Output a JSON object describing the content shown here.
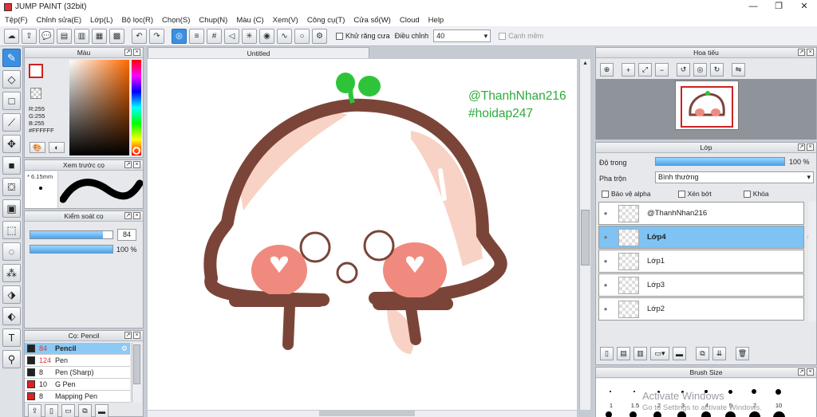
{
  "window": {
    "title": "JUMP PAINT (32bit)",
    "minimize": "—",
    "maximize": "❐",
    "close": "✕"
  },
  "menu": [
    "Tệp(F)",
    "Chỉnh sửa(E)",
    "Lớp(L)",
    "Bộ lọc(R)",
    "Chọn(S)",
    "Chup(N)",
    "Màu (C)",
    "Xem(V)",
    "Công cụ(T)",
    "Cửa sổ(W)",
    "Cloud",
    "Help"
  ],
  "toolbar": {
    "antialias_label": "Khử răng cưa",
    "adjust_label": "Điều chỉnh",
    "adjust_value": "40",
    "margin_label": "Cạnh mềm"
  },
  "color_panel": {
    "title": "Màu",
    "r": "R:255",
    "g": "G:255",
    "b": "B:255",
    "hex": "#FFFFFF",
    "primary": "#ffffff",
    "secondary": "#22cc22"
  },
  "brush_preview": {
    "title": "Xem trước cọ",
    "size": "6.15mm"
  },
  "brush_control": {
    "title": "Kiểm soát cọ",
    "size_value": "84",
    "opacity_value": "100 %",
    "size_fraction": 0.88,
    "opacity_fraction": 1.0
  },
  "brush_panel": {
    "title": "Cọ: Pencil",
    "brushes": [
      {
        "size": "84",
        "name": "Pencil",
        "color": "#222222",
        "selected": true
      },
      {
        "size": "124",
        "name": "Pen",
        "color": "#222222",
        "selected": false
      },
      {
        "size": "8",
        "name": "Pen (Sharp)",
        "color": "#222222",
        "selected": false
      },
      {
        "size": "10",
        "name": "G Pen",
        "color": "#dd2222",
        "selected": false
      },
      {
        "size": "8",
        "name": "Mapping Pen",
        "color": "#dd2222",
        "selected": false
      }
    ]
  },
  "canvas": {
    "tab_title": "Untitled",
    "watermark_1": "@ThanhNhan216",
    "watermark_2": "#hoidap247"
  },
  "navigator": {
    "title": "Hoa tiếu"
  },
  "layers": {
    "title": "Lớp",
    "opacity_label": "Độ trong",
    "opacity_value": "100 %",
    "blend_label": "Pha trộn",
    "blend_value": "Bình thường",
    "protect_alpha": "Bảo vệ alpha",
    "clip": "Xén bớt",
    "lock": "Khóa",
    "items": [
      {
        "name": "@ThanhNhan216",
        "selected": false
      },
      {
        "name": "Lớp4",
        "selected": true
      },
      {
        "name": "Lớp1",
        "selected": false
      },
      {
        "name": "Lớp3",
        "selected": false
      },
      {
        "name": "Lớp2",
        "selected": false
      }
    ]
  },
  "brush_size": {
    "title": "Brush Size",
    "labels": [
      "1",
      "1.5",
      "2",
      "3",
      "4",
      "5",
      "7",
      "10"
    ],
    "activate_1": "Activate Windows",
    "activate_2": "Go to Settings to activate Windows."
  },
  "colors": {
    "accent": "#3c8fe0",
    "brown": "#7a4538",
    "peach": "#f8d2c4",
    "cheek": "#f08a7e",
    "leaf": "#2ec43a",
    "watermark": "#2eaa3c"
  }
}
